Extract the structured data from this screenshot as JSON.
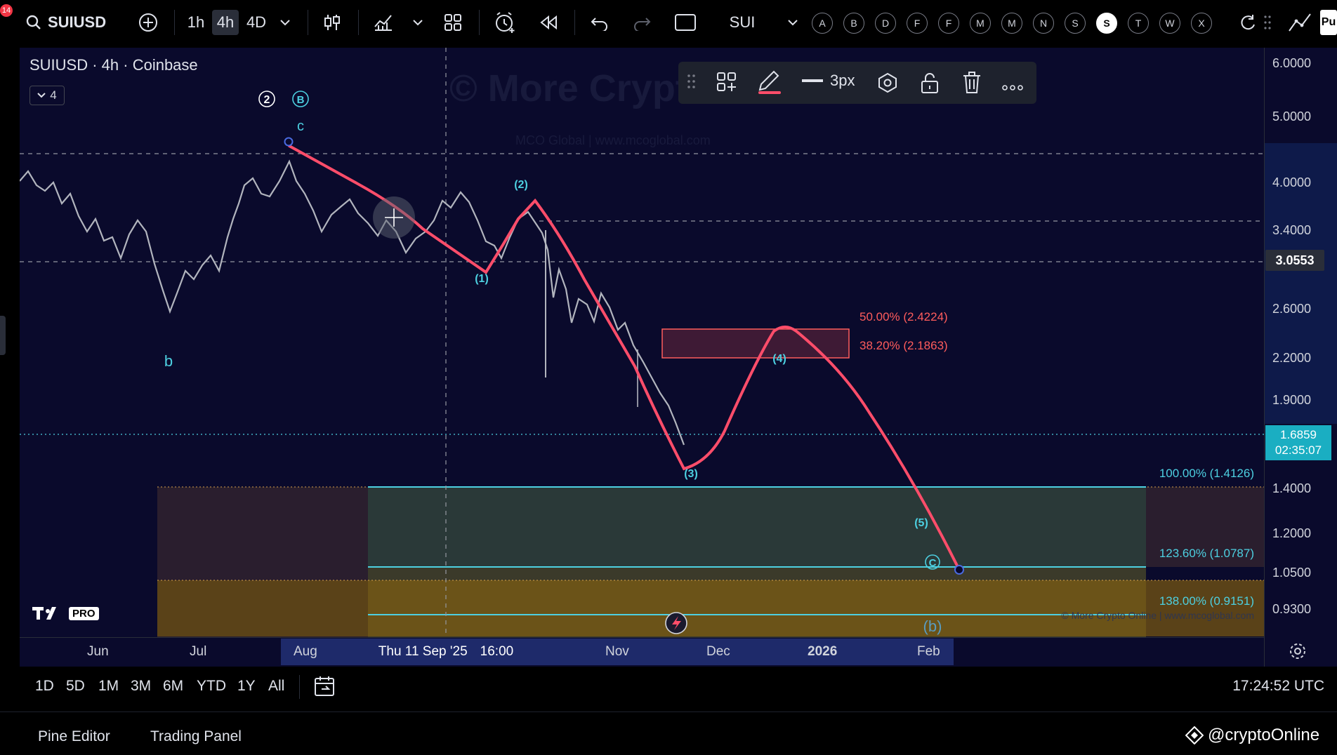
{
  "toolbar": {
    "notif": "14",
    "symbol": "SUIUSD",
    "intervals": [
      "1h",
      "4h",
      "4D"
    ],
    "active_interval": "4h",
    "watch_symbol": "SUI",
    "letters": [
      "A",
      "B",
      "D",
      "F",
      "F",
      "M",
      "M",
      "N",
      "S",
      "S",
      "T",
      "W",
      "X"
    ],
    "selected_letter_index": 9,
    "publish": "Pu"
  },
  "chart": {
    "title": "SUIUSD · 4h · Coinbase",
    "indicator_count": "4",
    "watermark": "© More Crypto",
    "watermark_sub": "MCO Global  |  www.mcoglobal.com",
    "credit": "© More Crypto Online  |  www.mcoglobal.com",
    "logo": "PRO",
    "price_axis": [
      "6.0000",
      "5.0000",
      "4.0000",
      "3.4000",
      "2.6000",
      "2.2000",
      "1.9000",
      "1.4000",
      "1.2000",
      "1.0500",
      "0.9300"
    ],
    "price_tag_1": "3.0553",
    "price_tag_2": "1.6859",
    "countdown": "02:35:07",
    "time_axis": [
      "Jun",
      "Jul",
      "Aug",
      "Nov",
      "Dec",
      "2026",
      "Feb"
    ],
    "crosshair_date": "Thu 11 Sep '25",
    "crosshair_time": "16:00",
    "fib_50": "50.00% (2.4224)",
    "fib_382": "38.20% (2.1863)",
    "fib_100": "100.00% (1.4126)",
    "fib_1236": "123.60% (1.0787)",
    "fib_138": "138.00% (0.9151)",
    "wave_labels": {
      "w2": "2",
      "wB": "B",
      "c": "c",
      "b": "b",
      "p1": "(1)",
      "p2": "(2)",
      "p3": "(3)",
      "p4": "(4)",
      "p5": "(5)",
      "C": "C",
      "pb": "(b)"
    }
  },
  "float_toolbar": {
    "width_label": "3px"
  },
  "bottom": {
    "ranges": [
      "1D",
      "5D",
      "1M",
      "3M",
      "6M",
      "YTD",
      "1Y",
      "All"
    ],
    "clock": "17:24:52 UTC",
    "tabs": [
      "Pine Editor",
      "Trading Panel"
    ],
    "brand": "@cryptoOnline"
  },
  "colors": {
    "accent": "#ff4d6a",
    "cyan": "#4dd0e1",
    "fib": "#ff5c5c"
  }
}
